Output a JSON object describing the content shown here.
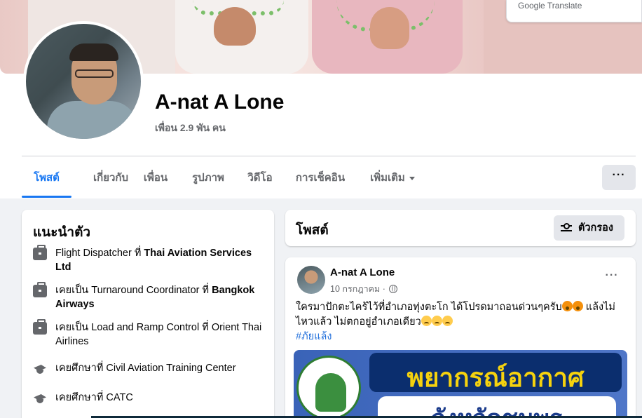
{
  "google_translate": {
    "label": "Google Translate"
  },
  "profile": {
    "name": "A-nat A Lone",
    "friends": "เพื่อน 2.9 พัน คน"
  },
  "tabs": [
    {
      "label": "โพสต์",
      "active": true
    },
    {
      "label": "เกี่ยวกับ"
    },
    {
      "label": "เพื่อน"
    },
    {
      "label": "รูปภาพ"
    },
    {
      "label": "วิดีโอ"
    },
    {
      "label": "การเช็คอิน"
    },
    {
      "label": "เพิ่มเติม"
    }
  ],
  "more_button": {
    "label": "···"
  },
  "intro": {
    "title": "แนะนำตัว",
    "items": [
      {
        "icon": "briefcase-icon",
        "prefix": "Flight Dispatcher ที่ ",
        "bold": "Thai Aviation Services Ltd"
      },
      {
        "icon": "briefcase-icon",
        "prefix": "เคยเป็น Turnaround Coordinator ที่ ",
        "bold": "Bangkok Airways"
      },
      {
        "icon": "briefcase-icon",
        "prefix": "เคยเป็น Load and Ramp Control ที่ Orient Thai Airlines",
        "bold": ""
      },
      {
        "icon": "graduation-cap-icon",
        "prefix": "เคยศึกษาที่ Civil Aviation Training Center",
        "bold": ""
      },
      {
        "icon": "graduation-cap-icon",
        "prefix": "เคยศึกษาที่ CATC",
        "bold": ""
      }
    ]
  },
  "posts_header": {
    "title": "โพสต์",
    "filter_label": "ตัวกรอง"
  },
  "post": {
    "author": "A-nat A Lone",
    "date": "10 กรกฎาคม",
    "separator": "·",
    "text_line1": "ใครมาปักตะไคร้ไว้ที่อำเภอทุ่งตะโก  ได้โปรดมาถอนด่วนๆครับ",
    "text_line1_end": "  แล้งไม่",
    "text_line2": "ไหวแล้ว  ไม่ตกอยู่อำเภอเดียว",
    "hashtag": "#ภัยแล้ง",
    "more": "···",
    "image": {
      "headline": "พยากรณ์อากาศ",
      "subline": "จังหวัดชุมพร"
    }
  },
  "colors": {
    "accent": "#1877f2",
    "text_secondary": "#65676b",
    "hashtag": "#216fdb",
    "background": "#f0f2f5"
  }
}
